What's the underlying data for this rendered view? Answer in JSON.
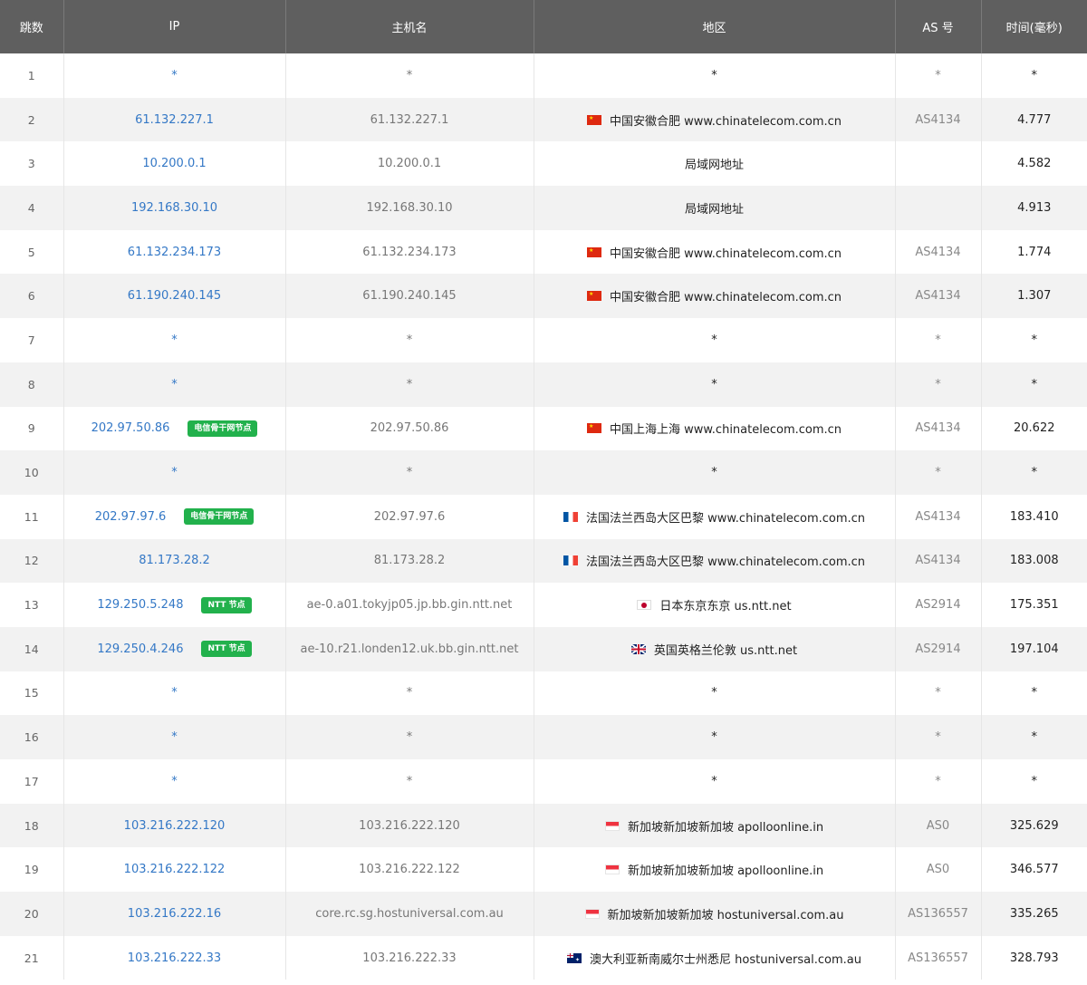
{
  "columns": [
    "跳数",
    "IP",
    "主机名",
    "地区",
    "AS 号",
    "时间(毫秒)"
  ],
  "colors": {
    "header_bg": "#5f5f5f",
    "ip_link": "#3478c6",
    "badge_green": "#22b14c"
  },
  "rows": [
    {
      "hop": "1",
      "ip": "*",
      "badge": "",
      "host": "*",
      "flag": "",
      "region": "*",
      "as": "*",
      "time": "*"
    },
    {
      "hop": "2",
      "ip": "61.132.227.1",
      "badge": "",
      "host": "61.132.227.1",
      "flag": "cn",
      "region": "中国安徽合肥 www.chinatelecom.com.cn",
      "as": "AS4134",
      "time": "4.777"
    },
    {
      "hop": "3",
      "ip": "10.200.0.1",
      "badge": "",
      "host": "10.200.0.1",
      "flag": "",
      "region": "局域网地址",
      "as": "",
      "time": "4.582"
    },
    {
      "hop": "4",
      "ip": "192.168.30.10",
      "badge": "",
      "host": "192.168.30.10",
      "flag": "",
      "region": "局域网地址",
      "as": "",
      "time": "4.913"
    },
    {
      "hop": "5",
      "ip": "61.132.234.173",
      "badge": "",
      "host": "61.132.234.173",
      "flag": "cn",
      "region": "中国安徽合肥 www.chinatelecom.com.cn",
      "as": "AS4134",
      "time": "1.774"
    },
    {
      "hop": "6",
      "ip": "61.190.240.145",
      "badge": "",
      "host": "61.190.240.145",
      "flag": "cn",
      "region": "中国安徽合肥 www.chinatelecom.com.cn",
      "as": "AS4134",
      "time": "1.307"
    },
    {
      "hop": "7",
      "ip": "*",
      "badge": "",
      "host": "*",
      "flag": "",
      "region": "*",
      "as": "*",
      "time": "*"
    },
    {
      "hop": "8",
      "ip": "*",
      "badge": "",
      "host": "*",
      "flag": "",
      "region": "*",
      "as": "*",
      "time": "*"
    },
    {
      "hop": "9",
      "ip": "202.97.50.86",
      "badge": "电信骨干网节点",
      "host": "202.97.50.86",
      "flag": "cn",
      "region": "中国上海上海 www.chinatelecom.com.cn",
      "as": "AS4134",
      "time": "20.622"
    },
    {
      "hop": "10",
      "ip": "*",
      "badge": "",
      "host": "*",
      "flag": "",
      "region": "*",
      "as": "*",
      "time": "*"
    },
    {
      "hop": "11",
      "ip": "202.97.97.6",
      "badge": "电信骨干网节点",
      "host": "202.97.97.6",
      "flag": "fr",
      "region": "法国法兰西岛大区巴黎 www.chinatelecom.com.cn",
      "as": "AS4134",
      "time": "183.410"
    },
    {
      "hop": "12",
      "ip": "81.173.28.2",
      "badge": "",
      "host": "81.173.28.2",
      "flag": "fr",
      "region": "法国法兰西岛大区巴黎 www.chinatelecom.com.cn",
      "as": "AS4134",
      "time": "183.008"
    },
    {
      "hop": "13",
      "ip": "129.250.5.248",
      "badge": "NTT 节点",
      "host": "ae-0.a01.tokyjp05.jp.bb.gin.ntt.net",
      "flag": "jp",
      "region": "日本东京东京 us.ntt.net",
      "as": "AS2914",
      "time": "175.351"
    },
    {
      "hop": "14",
      "ip": "129.250.4.246",
      "badge": "NTT 节点",
      "host": "ae-10.r21.londen12.uk.bb.gin.ntt.net",
      "flag": "gb",
      "region": "英国英格兰伦敦 us.ntt.net",
      "as": "AS2914",
      "time": "197.104"
    },
    {
      "hop": "15",
      "ip": "*",
      "badge": "",
      "host": "*",
      "flag": "",
      "region": "*",
      "as": "*",
      "time": "*"
    },
    {
      "hop": "16",
      "ip": "*",
      "badge": "",
      "host": "*",
      "flag": "",
      "region": "*",
      "as": "*",
      "time": "*"
    },
    {
      "hop": "17",
      "ip": "*",
      "badge": "",
      "host": "*",
      "flag": "",
      "region": "*",
      "as": "*",
      "time": "*"
    },
    {
      "hop": "18",
      "ip": "103.216.222.120",
      "badge": "",
      "host": "103.216.222.120",
      "flag": "sg",
      "region": "新加坡新加坡新加坡 apolloonline.in",
      "as": "AS0",
      "time": "325.629"
    },
    {
      "hop": "19",
      "ip": "103.216.222.122",
      "badge": "",
      "host": "103.216.222.122",
      "flag": "sg",
      "region": "新加坡新加坡新加坡 apolloonline.in",
      "as": "AS0",
      "time": "346.577"
    },
    {
      "hop": "20",
      "ip": "103.216.222.16",
      "badge": "",
      "host": "core.rc.sg.hostuniversal.com.au",
      "flag": "sg",
      "region": "新加坡新加坡新加坡 hostuniversal.com.au",
      "as": "AS136557",
      "time": "335.265"
    },
    {
      "hop": "21",
      "ip": "103.216.222.33",
      "badge": "",
      "host": "103.216.222.33",
      "flag": "au",
      "region": "澳大利亚新南威尔士州悉尼 hostuniversal.com.au",
      "as": "AS136557",
      "time": "328.793"
    }
  ]
}
